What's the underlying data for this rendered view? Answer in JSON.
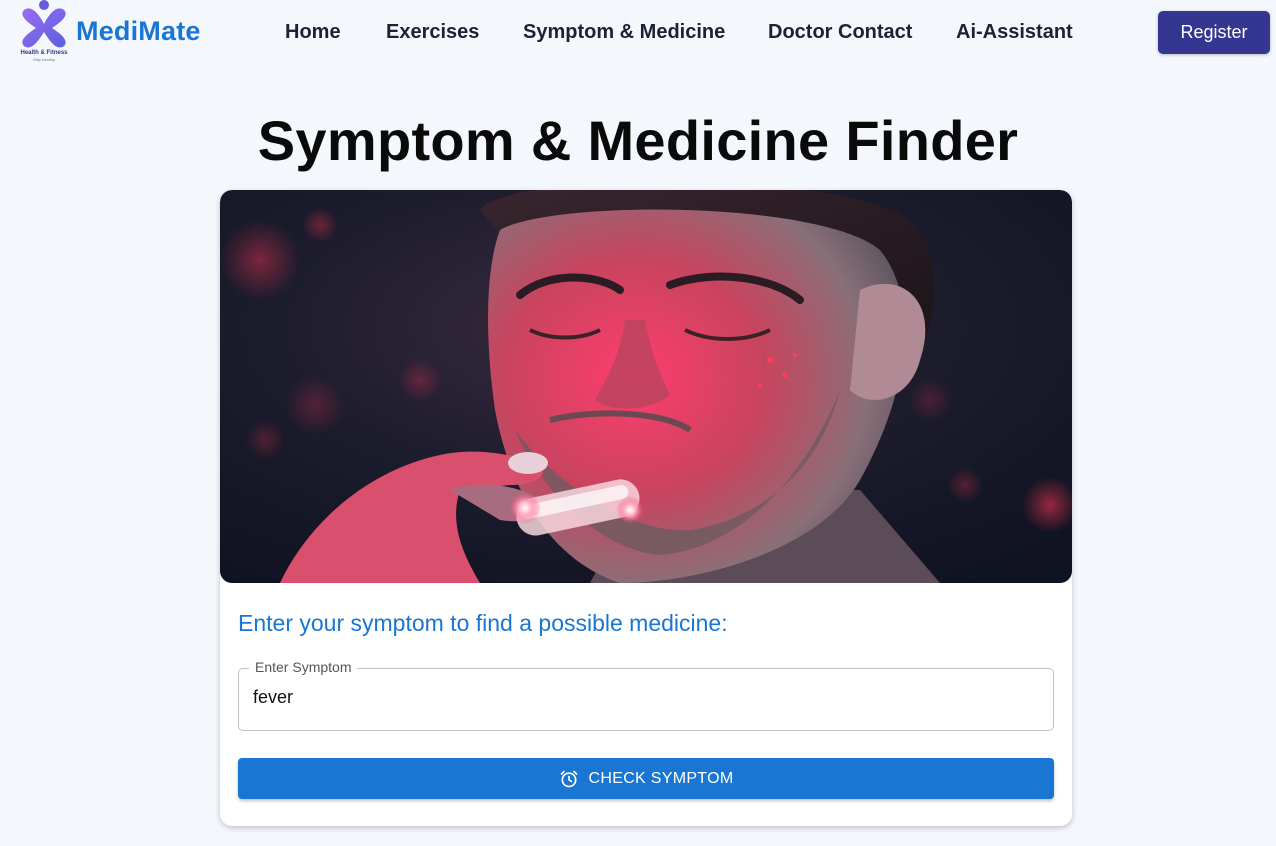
{
  "brand": {
    "name": "MediMate",
    "tagline": "Health & Fitness",
    "subtagline": "Stay healthy",
    "logo_icon": "medimate-logo-icon"
  },
  "nav": {
    "items": [
      {
        "label": "Home"
      },
      {
        "label": "Exercises"
      },
      {
        "label": "Symptom & Medicine"
      },
      {
        "label": "Doctor Contact"
      },
      {
        "label": "Ai-Assistant"
      }
    ],
    "register_label": "Register"
  },
  "page": {
    "title": "Symptom & Medicine Finder"
  },
  "finder": {
    "hero_image": "man-with-pill-photo",
    "prompt": "Enter your symptom to find a possible medicine:",
    "input_label": "Enter Symptom",
    "input_value": "fever",
    "button_label": "CHECK SYMPTOM",
    "button_icon": "alarm-clock-icon"
  },
  "colors": {
    "accent": "#1976d2",
    "register_bg": "#343792",
    "page_bg": "#f4f8fd"
  }
}
